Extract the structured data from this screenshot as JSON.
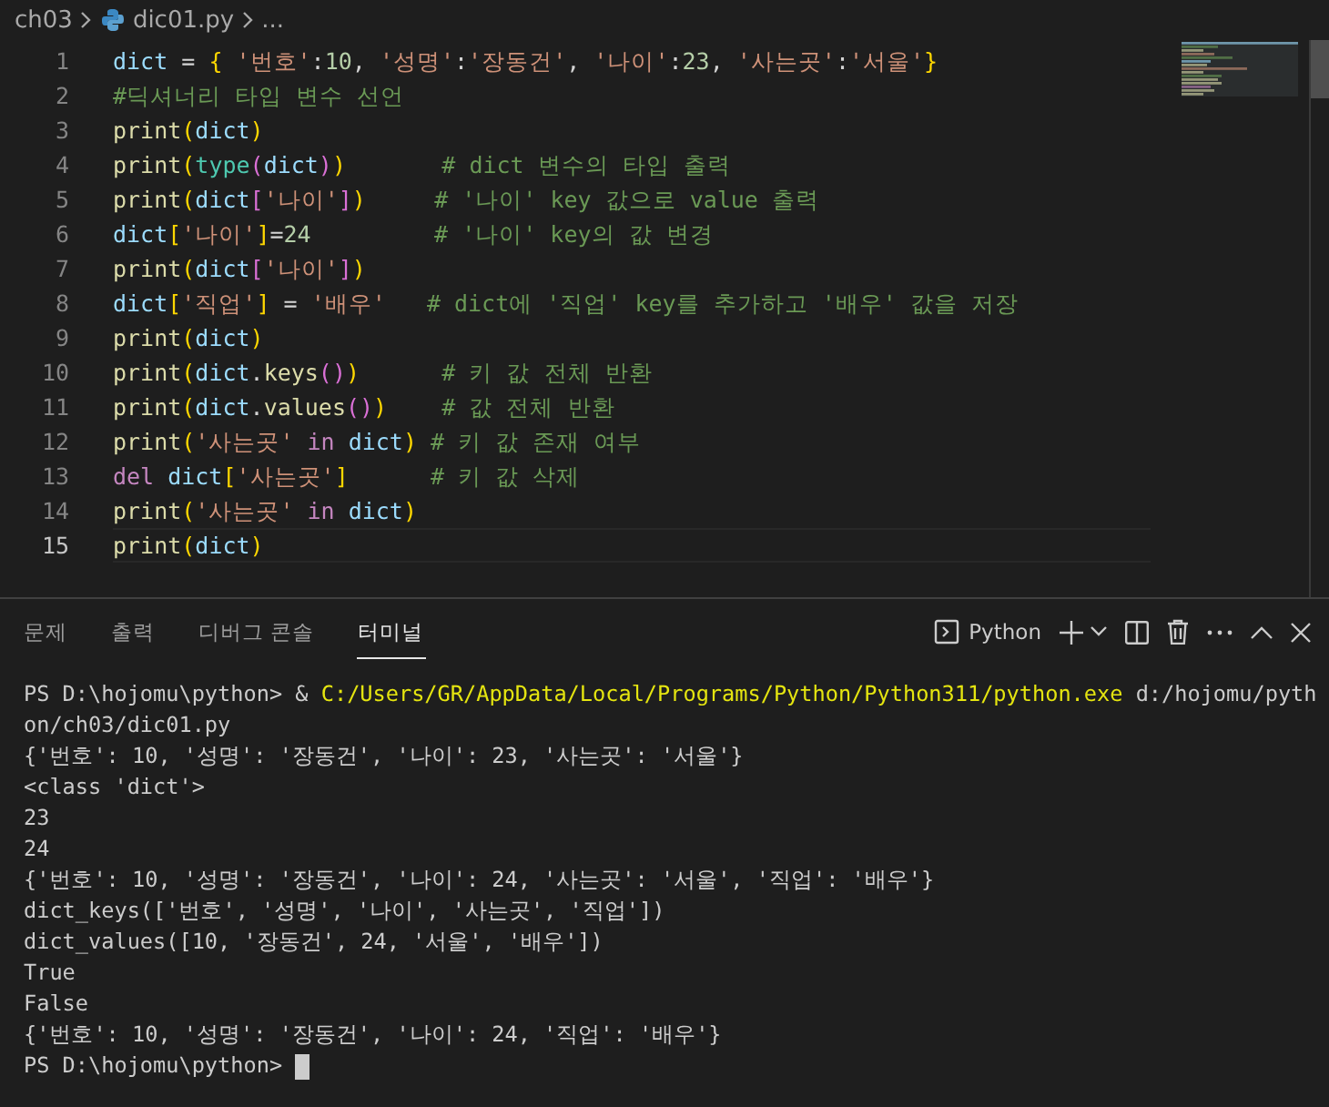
{
  "breadcrumb": {
    "items": [
      {
        "kind": "folder",
        "label": "ch03"
      },
      {
        "kind": "python-file",
        "label": "dic01.py"
      },
      {
        "kind": "more",
        "label": "..."
      }
    ]
  },
  "editor": {
    "lines": [
      {
        "number": "1",
        "current": false,
        "tokens": [
          {
            "kind": "var",
            "text": "dict"
          },
          {
            "kind": "op",
            "text": " = "
          },
          {
            "kind": "b1",
            "text": "{"
          },
          {
            "kind": "str",
            "text": " '번호'"
          },
          {
            "kind": "op",
            "text": ":"
          },
          {
            "kind": "num",
            "text": "10"
          },
          {
            "kind": "op",
            "text": ", "
          },
          {
            "kind": "str",
            "text": "'성명'"
          },
          {
            "kind": "op",
            "text": ":"
          },
          {
            "kind": "str",
            "text": "'장동건'"
          },
          {
            "kind": "op",
            "text": ", "
          },
          {
            "kind": "str",
            "text": "'나이'"
          },
          {
            "kind": "op",
            "text": ":"
          },
          {
            "kind": "num",
            "text": "23"
          },
          {
            "kind": "op",
            "text": ", "
          },
          {
            "kind": "str",
            "text": "'사는곳'"
          },
          {
            "kind": "op",
            "text": ":"
          },
          {
            "kind": "str",
            "text": "'서울'"
          },
          {
            "kind": "b1",
            "text": "}"
          }
        ]
      },
      {
        "number": "2",
        "current": false,
        "tokens": [
          {
            "kind": "comment",
            "text": "#딕셔너리 타입 변수 선언"
          }
        ]
      },
      {
        "number": "3",
        "current": false,
        "tokens": [
          {
            "kind": "fn",
            "text": "print"
          },
          {
            "kind": "b1",
            "text": "("
          },
          {
            "kind": "var",
            "text": "dict"
          },
          {
            "kind": "b1",
            "text": ")"
          }
        ]
      },
      {
        "number": "4",
        "current": false,
        "tokens": [
          {
            "kind": "fn",
            "text": "print"
          },
          {
            "kind": "b1",
            "text": "("
          },
          {
            "kind": "type",
            "text": "type"
          },
          {
            "kind": "b2",
            "text": "("
          },
          {
            "kind": "var",
            "text": "dict"
          },
          {
            "kind": "b2",
            "text": ")"
          },
          {
            "kind": "b1",
            "text": ")"
          },
          {
            "kind": "comment",
            "text": "       # dict 변수의 타입 출력"
          }
        ]
      },
      {
        "number": "5",
        "current": false,
        "tokens": [
          {
            "kind": "fn",
            "text": "print"
          },
          {
            "kind": "b1",
            "text": "("
          },
          {
            "kind": "var",
            "text": "dict"
          },
          {
            "kind": "b2",
            "text": "["
          },
          {
            "kind": "str",
            "text": "'나이'"
          },
          {
            "kind": "b2",
            "text": "]"
          },
          {
            "kind": "b1",
            "text": ")"
          },
          {
            "kind": "comment",
            "text": "     # '나이' key 값으로 value 출력"
          }
        ]
      },
      {
        "number": "6",
        "current": false,
        "tokens": [
          {
            "kind": "var",
            "text": "dict"
          },
          {
            "kind": "b1",
            "text": "["
          },
          {
            "kind": "str",
            "text": "'나이'"
          },
          {
            "kind": "b1",
            "text": "]"
          },
          {
            "kind": "op",
            "text": "="
          },
          {
            "kind": "num",
            "text": "24"
          },
          {
            "kind": "comment",
            "text": "         # '나이' key의 값 변경"
          }
        ]
      },
      {
        "number": "7",
        "current": false,
        "tokens": [
          {
            "kind": "fn",
            "text": "print"
          },
          {
            "kind": "b1",
            "text": "("
          },
          {
            "kind": "var",
            "text": "dict"
          },
          {
            "kind": "b2",
            "text": "["
          },
          {
            "kind": "str",
            "text": "'나이'"
          },
          {
            "kind": "b2",
            "text": "]"
          },
          {
            "kind": "b1",
            "text": ")"
          }
        ]
      },
      {
        "number": "8",
        "current": false,
        "tokens": [
          {
            "kind": "var",
            "text": "dict"
          },
          {
            "kind": "b1",
            "text": "["
          },
          {
            "kind": "str",
            "text": "'직업'"
          },
          {
            "kind": "b1",
            "text": "]"
          },
          {
            "kind": "op",
            "text": " = "
          },
          {
            "kind": "str",
            "text": "'배우'"
          },
          {
            "kind": "comment",
            "text": "   # dict에 '직업' key를 추가하고 '배우' 값을 저장"
          }
        ]
      },
      {
        "number": "9",
        "current": false,
        "tokens": [
          {
            "kind": "fn",
            "text": "print"
          },
          {
            "kind": "b1",
            "text": "("
          },
          {
            "kind": "var",
            "text": "dict"
          },
          {
            "kind": "b1",
            "text": ")"
          }
        ]
      },
      {
        "number": "10",
        "current": false,
        "tokens": [
          {
            "kind": "fn",
            "text": "print"
          },
          {
            "kind": "b1",
            "text": "("
          },
          {
            "kind": "var",
            "text": "dict"
          },
          {
            "kind": "op",
            "text": "."
          },
          {
            "kind": "fn",
            "text": "keys"
          },
          {
            "kind": "b2",
            "text": "()"
          },
          {
            "kind": "b1",
            "text": ")"
          },
          {
            "kind": "comment",
            "text": "      # 키 값 전체 반환"
          }
        ]
      },
      {
        "number": "11",
        "current": false,
        "tokens": [
          {
            "kind": "fn",
            "text": "print"
          },
          {
            "kind": "b1",
            "text": "("
          },
          {
            "kind": "var",
            "text": "dict"
          },
          {
            "kind": "op",
            "text": "."
          },
          {
            "kind": "fn",
            "text": "values"
          },
          {
            "kind": "b2",
            "text": "()"
          },
          {
            "kind": "b1",
            "text": ")"
          },
          {
            "kind": "comment",
            "text": "    # 값 전체 반환"
          }
        ]
      },
      {
        "number": "12",
        "current": false,
        "tokens": [
          {
            "kind": "fn",
            "text": "print"
          },
          {
            "kind": "b1",
            "text": "("
          },
          {
            "kind": "str",
            "text": "'사는곳'"
          },
          {
            "kind": "kw",
            "text": " in "
          },
          {
            "kind": "var",
            "text": "dict"
          },
          {
            "kind": "b1",
            "text": ")"
          },
          {
            "kind": "comment",
            "text": " # 키 값 존재 여부"
          }
        ]
      },
      {
        "number": "13",
        "current": false,
        "tokens": [
          {
            "kind": "kw",
            "text": "del"
          },
          {
            "kind": "var",
            "text": " dict"
          },
          {
            "kind": "b1",
            "text": "["
          },
          {
            "kind": "str",
            "text": "'사는곳'"
          },
          {
            "kind": "b1",
            "text": "]"
          },
          {
            "kind": "comment",
            "text": "      # 키 값 삭제"
          }
        ]
      },
      {
        "number": "14",
        "current": false,
        "tokens": [
          {
            "kind": "fn",
            "text": "print"
          },
          {
            "kind": "b1",
            "text": "("
          },
          {
            "kind": "str",
            "text": "'사는곳'"
          },
          {
            "kind": "kw",
            "text": " in "
          },
          {
            "kind": "var",
            "text": "dict"
          },
          {
            "kind": "b1",
            "text": ")"
          }
        ]
      },
      {
        "number": "15",
        "current": true,
        "tokens": [
          {
            "kind": "fn",
            "text": "print"
          },
          {
            "kind": "b1",
            "text": "("
          },
          {
            "kind": "var",
            "text": "dict"
          },
          {
            "kind": "b1",
            "text": ")"
          }
        ]
      }
    ]
  },
  "panel": {
    "tabs": [
      {
        "label": "문제",
        "selected": false
      },
      {
        "label": "출력",
        "selected": false
      },
      {
        "label": "디버그 콘솔",
        "selected": false
      },
      {
        "label": "터미널",
        "selected": true
      }
    ],
    "terminal_name": "Python",
    "terminal": {
      "cursor": true,
      "lines": [
        [
          {
            "kind": "plain",
            "text": "PS D:\\hojomu\\python> & "
          },
          {
            "kind": "path",
            "text": "C:/Users/GR/AppData/Local/Programs/Python/Python311/python.exe"
          },
          {
            "kind": "plain",
            "text": " d:/hojomu/pyth"
          }
        ],
        [
          {
            "kind": "plain",
            "text": "on/ch03/dic01.py"
          }
        ],
        [
          {
            "kind": "plain",
            "text": "{'번호': 10, '성명': '장동건', '나이': 23, '사는곳': '서울'}"
          }
        ],
        [
          {
            "kind": "plain",
            "text": "<class 'dict'>"
          }
        ],
        [
          {
            "kind": "plain",
            "text": "23"
          }
        ],
        [
          {
            "kind": "plain",
            "text": "24"
          }
        ],
        [
          {
            "kind": "plain",
            "text": "{'번호': 10, '성명': '장동건', '나이': 24, '사는곳': '서울', '직업': '배우'}"
          }
        ],
        [
          {
            "kind": "plain",
            "text": "dict_keys(['번호', '성명', '나이', '사는곳', '직업'])"
          }
        ],
        [
          {
            "kind": "plain",
            "text": "dict_values([10, '장동건', 24, '서울', '배우'])"
          }
        ],
        [
          {
            "kind": "plain",
            "text": "True"
          }
        ],
        [
          {
            "kind": "plain",
            "text": "False"
          }
        ],
        [
          {
            "kind": "plain",
            "text": "{'번호': 10, '성명': '장동건', '나이': 24, '직업': '배우'}"
          }
        ],
        [
          {
            "kind": "plain",
            "text": "PS D:\\hojomu\\python> "
          }
        ]
      ]
    }
  }
}
